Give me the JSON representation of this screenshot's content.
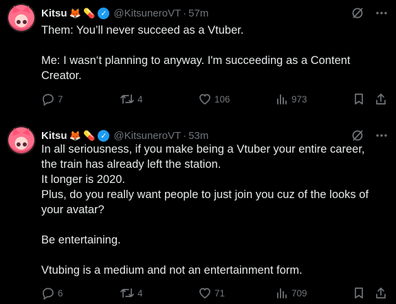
{
  "tweets": [
    {
      "display_name": "Kitsu",
      "emojis": [
        "🦊",
        "💊"
      ],
      "handle": "@KitsuneroVT",
      "separator": "·",
      "time": "57m",
      "lines": [
        "Them: You’ll never succeed as a Vtuber.",
        "",
        "Me: I wasn‘t planning to anyway. I'm succeeding as a Content",
        "Creator."
      ],
      "replies": "7",
      "retweets": "4",
      "likes": "106",
      "views": "973"
    },
    {
      "display_name": "Kitsu",
      "emojis": [
        "🦊",
        "💊"
      ],
      "handle": "@KitsuneroVT",
      "separator": "·",
      "time": "53m",
      "lines": [
        "In all seriousness, if you make being a Vtuber your entire career,",
        "the train has already left the station.",
        "It longer is 2020.",
        "Plus, do you really want people to just join you cuz of the looks of",
        "your avatar?",
        "",
        "Be entertaining.",
        "",
        "Vtubing is a medium and not an entertainment form."
      ],
      "replies": "6",
      "retweets": "4",
      "likes": "71",
      "views": "709"
    }
  ],
  "colors": {
    "background": "#000000",
    "text": "#e7e9ea",
    "muted": "#71767b",
    "verified": "#1d9bf0"
  },
  "icons": [
    "grok-icon",
    "more-icon",
    "reply-icon",
    "retweet-icon",
    "like-icon",
    "views-icon",
    "bookmark-icon",
    "share-icon",
    "verified-badge-icon"
  ]
}
